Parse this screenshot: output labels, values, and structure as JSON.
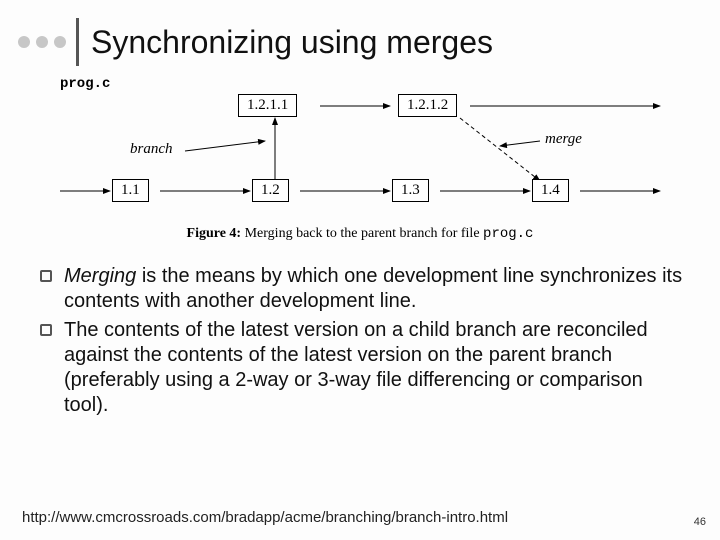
{
  "title": "Synchronizing using merges",
  "diagram": {
    "file_label": "prog.c",
    "branch_label": "branch",
    "merge_label": "merge",
    "trunk": [
      "1.1",
      "1.2",
      "1.3",
      "1.4"
    ],
    "branch": [
      "1.2.1.1",
      "1.2.1.2"
    ],
    "caption_fig": "Figure 4:",
    "caption_text": "Merging back to the parent branch for file",
    "caption_file": "prog.c"
  },
  "bullets": [
    {
      "em": "Merging",
      "rest": " is the means by which one development line synchronizes its contents with another development line."
    },
    {
      "em": "",
      "rest": "The contents of the latest version on a child branch are reconciled against the contents of the latest version on the parent branch (preferably using a 2-way or 3-way file differencing or comparison tool)."
    }
  ],
  "footer_url": "http://www.cmcrossroads.com/bradapp/acme/branching/branch-intro.html",
  "slide_number": "46"
}
